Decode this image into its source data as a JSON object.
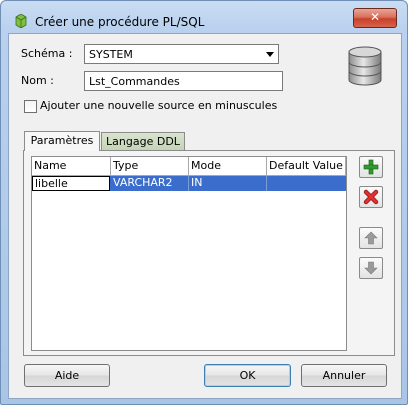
{
  "window": {
    "title": "Créer une procédure PL/SQL",
    "close_glyph": "✕"
  },
  "form": {
    "schema_label": "Schéma :",
    "schema_value": "SYSTEM",
    "name_label": "Nom :",
    "name_value": "Lst_Commandes",
    "lowercase_checkbox_label": "Ajouter une nouvelle source en minuscules",
    "lowercase_checked": false
  },
  "tabs": [
    {
      "label": "Paramètres",
      "active": true
    },
    {
      "label": "Langage DDL",
      "active": false
    }
  ],
  "parameters_table": {
    "columns": [
      "Name",
      "Type",
      "Mode",
      "Default Value"
    ],
    "rows": [
      {
        "name": "libelle",
        "type": "VARCHAR2",
        "mode": "IN",
        "default": ""
      }
    ]
  },
  "side_buttons": {
    "add_icon": "plus-icon",
    "remove_icon": "remove-icon",
    "up_icon": "arrow-up-icon",
    "down_icon": "arrow-down-icon"
  },
  "footer": {
    "help_label": "Aide",
    "ok_label": "OK",
    "cancel_label": "Annuler"
  },
  "colors": {
    "selection": "#3b6ecc",
    "add_green": "#2e9b2e",
    "remove_red": "#cc2020"
  }
}
